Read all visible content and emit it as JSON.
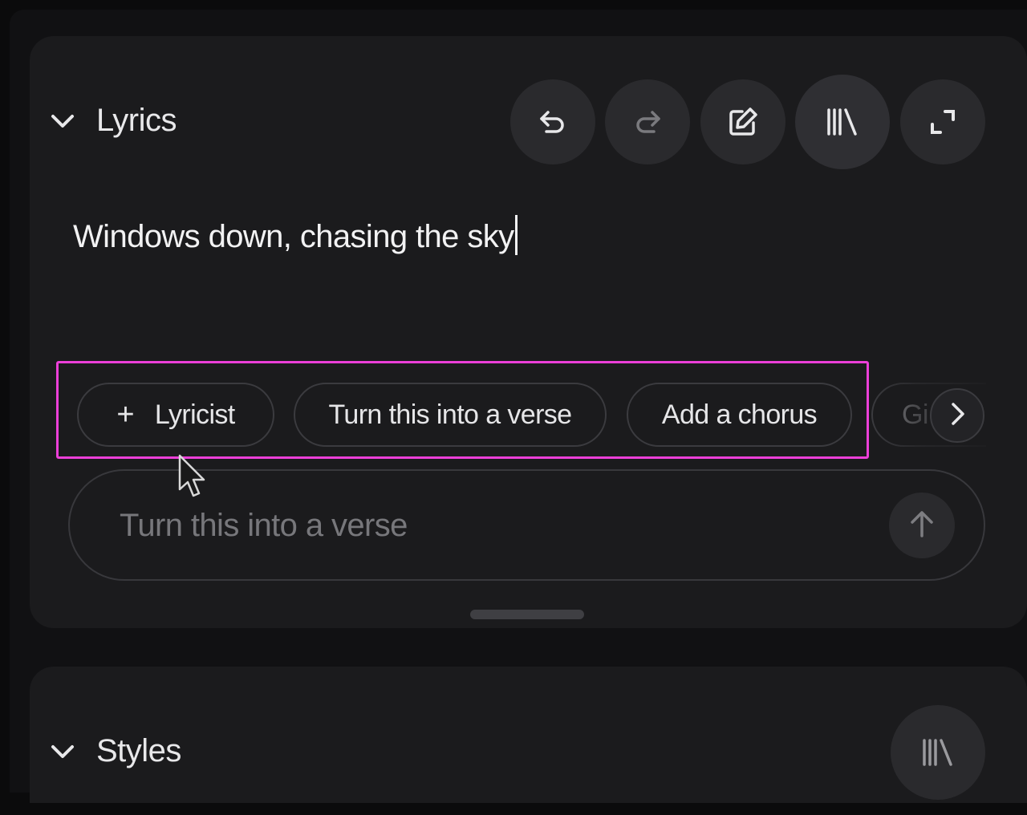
{
  "lyrics_section": {
    "title": "Lyrics",
    "content": "Windows down, chasing the sky",
    "toolbar": {
      "undo": "undo-icon",
      "redo": "redo-icon",
      "edit": "edit-icon",
      "library": "library-icon",
      "expand": "expand-icon"
    }
  },
  "suggestions": {
    "chips": [
      {
        "label": "Lyricist",
        "icon": "plus-icon"
      },
      {
        "label": "Turn this into a verse"
      },
      {
        "label": "Add a chorus"
      },
      {
        "label": "Gi"
      }
    ],
    "next_icon": "chevron-right-icon"
  },
  "prompt": {
    "placeholder": "Turn this into a verse",
    "send_icon": "arrow-up-icon"
  },
  "styles_section": {
    "title": "Styles",
    "library_icon": "library-icon"
  },
  "colors": {
    "highlight": "#ec3fd8",
    "card_bg": "#1b1b1d",
    "button_bg": "#2a2a2d"
  }
}
